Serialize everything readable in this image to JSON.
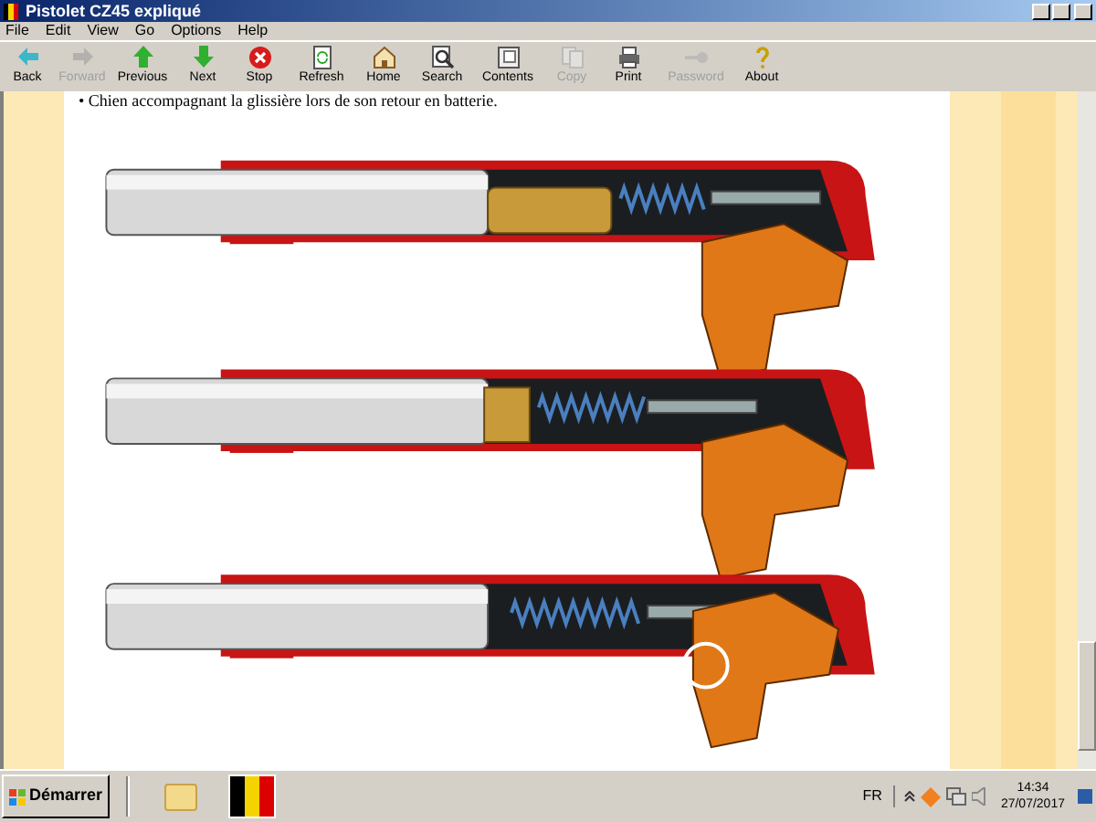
{
  "window": {
    "title": "Pistolet CZ45 expliqué"
  },
  "menu": [
    "File",
    "Edit",
    "View",
    "Go",
    "Options",
    "Help"
  ],
  "toolbar": [
    {
      "label": "Back",
      "disabled": false
    },
    {
      "label": "Forward",
      "disabled": true
    },
    {
      "label": "Previous",
      "disabled": false
    },
    {
      "label": "Next",
      "disabled": false
    },
    {
      "label": "Stop",
      "disabled": false
    },
    {
      "label": "Refresh",
      "disabled": false
    },
    {
      "label": "Home",
      "disabled": false
    },
    {
      "label": "Search",
      "disabled": false
    },
    {
      "label": "Contents",
      "disabled": false
    },
    {
      "label": "Copy",
      "disabled": true
    },
    {
      "label": "Print",
      "disabled": false
    },
    {
      "label": "Password",
      "disabled": true
    },
    {
      "label": "About",
      "disabled": false
    }
  ],
  "content": {
    "text": "• Chien accompagnant la glissière lors de son retour en batterie."
  },
  "taskbar": {
    "start": "Démarrer",
    "language": "FR",
    "time": "14:34",
    "date": "27/07/2017"
  }
}
